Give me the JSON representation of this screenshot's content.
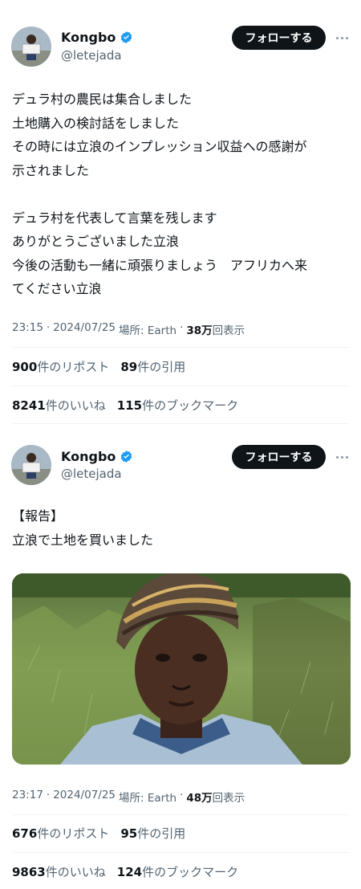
{
  "tweets": [
    {
      "author_name": "Kongbo",
      "handle": "@letejada",
      "follow_label": "フォローする",
      "body": "デュラ村の農民は集合しました\n土地購入の検討話をしました\nその時には立浪のインプレッション収益への感謝が\n示されました\n\nデュラ村を代表して言葉を残します\nありがとうございました立浪\n今後の活動も一緒に頑張りましょう　アフリカへ来\nてください立浪",
      "time": "23:15",
      "date": "2024/07/25",
      "place_label": "場所: Earth",
      "views_count": "38万",
      "views_label": "回表示",
      "reposts_count": "900",
      "reposts_label": "件のリポスト",
      "quotes_count": "89",
      "quotes_label": "件の引用",
      "likes_count": "8241",
      "likes_label": "件のいいね",
      "bookmarks_count": "115",
      "bookmarks_label": "件のブックマーク"
    },
    {
      "author_name": "Kongbo",
      "handle": "@letejada",
      "follow_label": "フォローする",
      "body": "【報告】\n立浪で土地を買いました",
      "time": "23:17",
      "date": "2024/07/25",
      "place_label": "場所: Earth",
      "views_count": "48万",
      "views_label": "回表示",
      "reposts_count": "676",
      "reposts_label": "件のリポスト",
      "quotes_count": "95",
      "quotes_label": "件の引用",
      "likes_count": "9863",
      "likes_label": "件のいいね",
      "bookmarks_count": "124",
      "bookmarks_label": "件のブックマーク"
    }
  ],
  "meta_separator": "·",
  "colors": {
    "verified": "#1d9bf0",
    "follow_button": "#0f1419",
    "secondary_text": "#536471"
  },
  "icons": {
    "verified": "verified-badge-icon",
    "more": "more-horizontal-icon"
  }
}
